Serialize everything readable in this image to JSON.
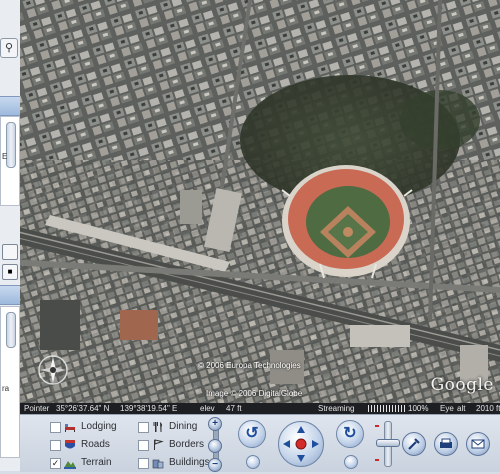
{
  "sidebar": {
    "search_icon": "magnifier-icon",
    "partial_text_1": "E",
    "partial_text_2": "ra"
  },
  "map": {
    "credit_top": "© 2006 Europa Technologies",
    "credit_bottom": "Image © 2006 DigitalGlobe",
    "logo": "Google",
    "compass_north": "N"
  },
  "status": {
    "pointer_label": "Pointer",
    "pointer_lat": "35°26'37.64\" N",
    "pointer_lon": "139°38'19.54\" E",
    "elev_label": "elev",
    "elev_value": "47 ft",
    "streaming_label": "Streaming",
    "streaming_percent": "100%",
    "eye_label": "Eye",
    "eye_value": "alt",
    "eye_alt": "2010 ft"
  },
  "layers": [
    {
      "label": "Lodging",
      "checked": false,
      "icon": "bed-icon"
    },
    {
      "label": "Roads",
      "checked": false,
      "icon": "road-shield-icon"
    },
    {
      "label": "Terrain",
      "checked": true,
      "icon": "terrain-icon"
    },
    {
      "label": "Dining",
      "checked": false,
      "icon": "fork-knife-icon"
    },
    {
      "label": "Borders",
      "checked": false,
      "icon": "flag-icon"
    },
    {
      "label": "Buildings",
      "checked": false,
      "icon": "building-icon"
    }
  ],
  "colors": {
    "accent": "#1f4f9c",
    "status_bg": "#1d1f22",
    "panel_bg": "#d3dbe6"
  }
}
